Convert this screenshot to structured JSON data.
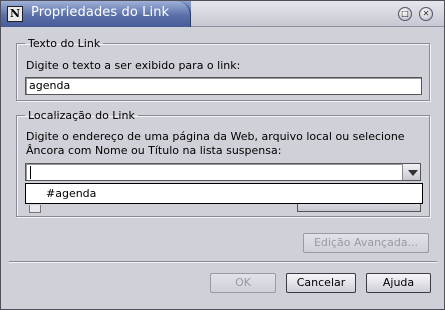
{
  "window": {
    "title": "Propriedades do Link",
    "app_icon_glyph": "N",
    "maximize_glyph": "□",
    "close_glyph": "✕"
  },
  "link_text_group": {
    "legend": "Texto do Link",
    "instruction": "Digite o texto a ser exibido para o link:",
    "value": "agenda"
  },
  "location_group": {
    "legend": "Localização do Link",
    "instruction_line1": "Digite o endereço de uma página da Web, arquivo local ou selecione",
    "instruction_line2": "Âncora com Nome ou Título na lista suspensa:",
    "value": "",
    "dropdown_items": [
      "#agenda"
    ]
  },
  "buttons": {
    "advanced_edit": "Edição Avançada...",
    "ok": "OK",
    "cancel": "Cancelar",
    "help": "Ajuda"
  },
  "colors": {
    "title_bar": "#4e64a0",
    "dialog_background": "#d0d0d8"
  }
}
